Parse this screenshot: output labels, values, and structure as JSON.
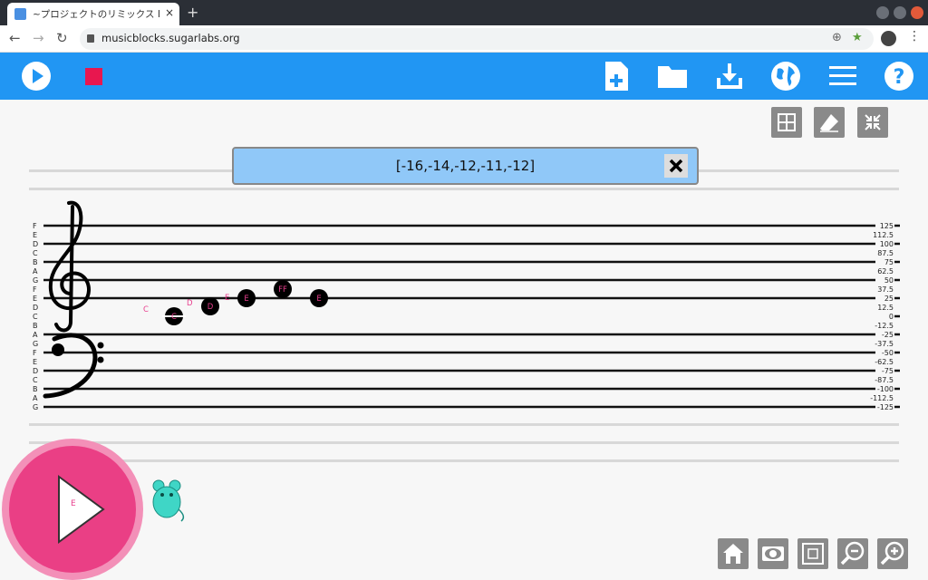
{
  "browser": {
    "tab_title": "~プロジェクトのリミックス Inte",
    "tab_close": "×",
    "new_tab": "+",
    "url": "musicblocks.sugarlabs.org"
  },
  "popup": {
    "text": "[-16,-14,-12,-11,-12]"
  },
  "staff": {
    "left_labels": [
      "F",
      "E",
      "D",
      "C",
      "B",
      "A",
      "G",
      "F",
      "E",
      "D",
      "C",
      "B",
      "A",
      "G",
      "F",
      "E",
      "D",
      "C",
      "B",
      "A",
      "G"
    ],
    "right_labels": [
      "125",
      "112.5",
      "100",
      "87.5",
      "75",
      "62.5",
      "50",
      "37.5",
      "25",
      "12.5",
      "0",
      "-12.5",
      "-25",
      "-37.5",
      "-50",
      "-62.5",
      "-75",
      "-87.5",
      "-100",
      "-112.5",
      "-125"
    ]
  },
  "notes": [
    {
      "label": "C",
      "pitch_label": "C"
    },
    {
      "label": "D",
      "pitch_label": "D"
    },
    {
      "label": "E",
      "pitch_label": "E"
    },
    {
      "label": "FF",
      "pitch_label": ""
    },
    {
      "label": "E",
      "pitch_label": ""
    }
  ],
  "big_play_label": "E",
  "colors": {
    "toolbar": "#2196f3",
    "stop": "#e8174f",
    "play_button": "#ea3f85",
    "note": "#000000",
    "note_label": "#e83f8e"
  }
}
